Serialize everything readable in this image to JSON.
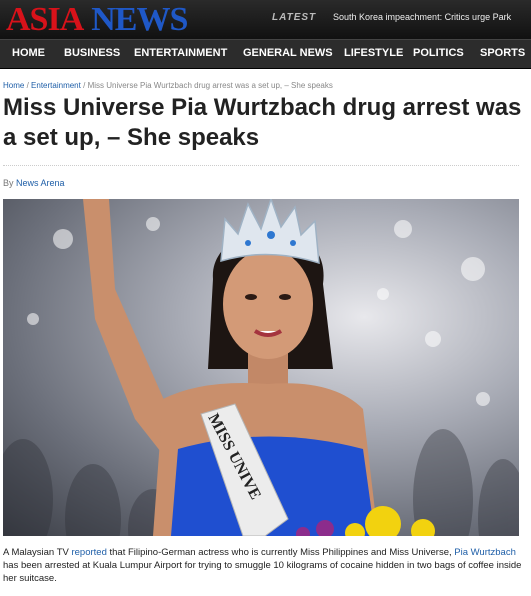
{
  "header": {
    "logo_asia": "ASIA",
    "logo_news": "NEWS",
    "latest_label": "LATEST",
    "ticker_text": "South Korea impeachment: Critics urge Park"
  },
  "nav": {
    "items": [
      "HOME",
      "BUSINESS",
      "ENTERTAINMENT",
      "GENERAL NEWS",
      "LIFESTYLE",
      "POLITICS",
      "SPORTS"
    ]
  },
  "breadcrumb": {
    "home": "Home",
    "section": "Entertainment",
    "current": "Miss Universe Pia Wurtzbach drug arrest was a set up, – She speaks"
  },
  "article": {
    "title": "Miss Universe Pia Wurtzbach drug arrest was a set up, – She speaks",
    "by_label": "By",
    "author": "News Arena",
    "sash_text": "MISS UNIVE",
    "body_part1": "A Malaysian TV ",
    "body_link1": "reported",
    "body_part2": " that Filipino-German actress who is currently Miss Philippines and Miss Universe, ",
    "body_link2": "Pia Wurtzbach",
    "body_part3": " has been arrested at Kuala Lumpur Airport for trying to smuggle 10 kilograms of cocaine hidden in two bags of coffee inside her suitcase."
  },
  "colors": {
    "logo_red": "#d8121a",
    "logo_blue": "#1f58c7",
    "link_blue": "#1f5fa8",
    "nav_bg": "#2c2c2c",
    "gown_blue": "#1f4fd0"
  }
}
